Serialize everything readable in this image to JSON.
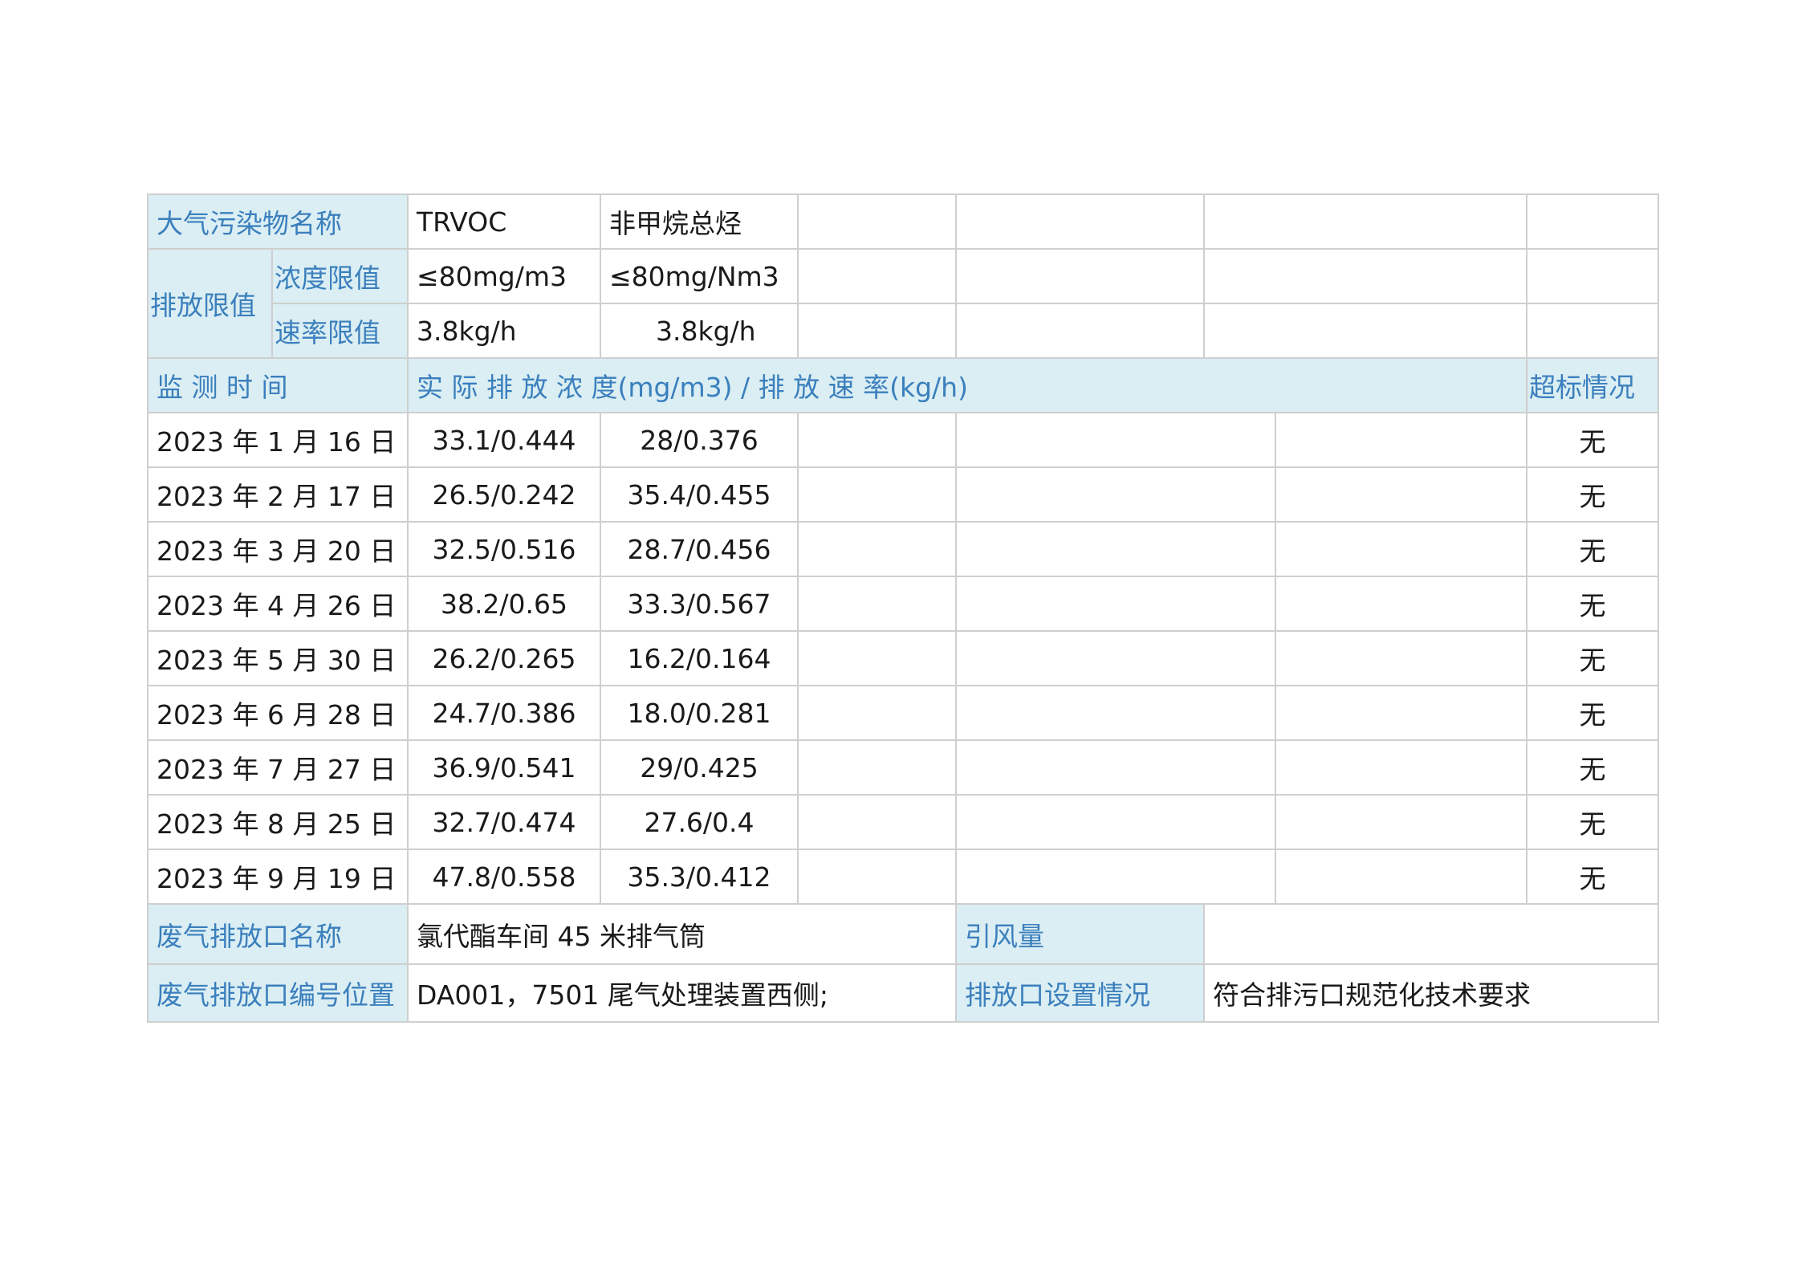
{
  "limits": {
    "pollutant_label": "大气污染物名称",
    "pollutants": [
      "TRVOC",
      "非甲烷总烃"
    ],
    "emission_limit_label": "排放限值",
    "concentration_label": "浓度限值",
    "concentration_values": [
      "≤80mg/m3",
      "≤80mg/Nm3"
    ],
    "rate_label": "速率限值",
    "rate_values": [
      "3.8kg/h",
      "3.8kg/h"
    ]
  },
  "monitoring": {
    "time_header": "监 测 时 间",
    "value_header": "实 际 排 放 浓 度(mg/m3) / 排 放 速 率(kg/h)",
    "exceed_header": "超标情况",
    "rows": [
      {
        "date": "2023 年 1 月 16 日",
        "v1": "33.1/0.444",
        "v2": "28/0.376",
        "exceed": "无"
      },
      {
        "date": "2023 年 2 月 17 日",
        "v1": "26.5/0.242",
        "v2": "35.4/0.455",
        "exceed": "无"
      },
      {
        "date": "2023 年 3 月 20 日",
        "v1": "32.5/0.516",
        "v2": "28.7/0.456",
        "exceed": "无"
      },
      {
        "date": "2023 年 4 月 26 日",
        "v1": "38.2/0.65",
        "v2": "33.3/0.567",
        "exceed": "无"
      },
      {
        "date": "2023 年 5 月 30 日",
        "v1": "26.2/0.265",
        "v2": "16.2/0.164",
        "exceed": "无"
      },
      {
        "date": "2023 年 6 月 28 日",
        "v1": "24.7/0.386",
        "v2": "18.0/0.281",
        "exceed": "无"
      },
      {
        "date": "2023 年 7 月 27 日",
        "v1": "36.9/0.541",
        "v2": "29/0.425",
        "exceed": "无"
      },
      {
        "date": "2023 年 8 月 25 日",
        "v1": "32.7/0.474",
        "v2": "27.6/0.4",
        "exceed": "无"
      },
      {
        "date": "2023 年 9 月 19 日",
        "v1": "47.8/0.558",
        "v2": "35.3/0.412",
        "exceed": "无"
      }
    ]
  },
  "outlet": {
    "name_label": "废气排放口名称",
    "name_value": "氯代酯车间 45 米排气筒",
    "airflow_label": "引风量",
    "airflow_value": "",
    "code_label": "废气排放口编号位置",
    "code_value": "DA001，7501 尾气处理装置西侧;",
    "setting_label": "排放口设置情况",
    "setting_value": "符合排污口规范化技术要求"
  }
}
